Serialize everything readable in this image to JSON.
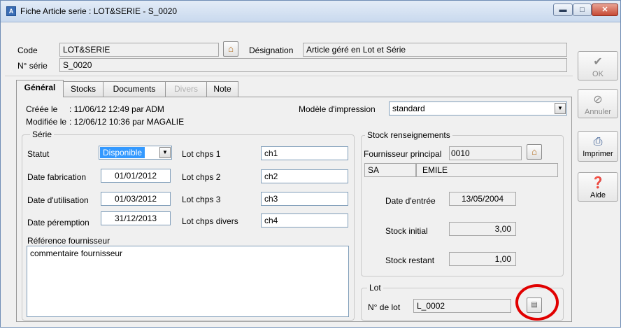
{
  "window": {
    "title": "Fiche Article serie : LOT&SERIE - S_0020",
    "icon": "app-icon",
    "controls": {
      "minimize": "▬",
      "maximize": "□",
      "close": "✕"
    }
  },
  "header": {
    "code_label": "Code",
    "code_value": "LOT&SERIE",
    "designation_label": "Désignation",
    "designation_value": "Article géré en Lot et Série",
    "serial_label": "N° série",
    "serial_value": "S_0020"
  },
  "sidebar": {
    "ok": "OK",
    "cancel": "Annuler",
    "print": "Imprimer",
    "help": "Aide"
  },
  "tabs": [
    {
      "label": "Général",
      "active": true
    },
    {
      "label": "Stocks"
    },
    {
      "label": "Documents"
    },
    {
      "label": "Divers",
      "disabled": true
    },
    {
      "label": "Note"
    }
  ],
  "general": {
    "created_label": "Créée le",
    "created_value": ": 11/06/12 12:49 par ADM",
    "modified_label": "Modifiée le",
    "modified_value": ": 12/06/12 10:36 par MAGALIE",
    "print_model_label": "Modèle d'impression",
    "print_model_value": "standard"
  },
  "serie": {
    "title": "Série",
    "status_label": "Statut",
    "status_value": "Disponible",
    "fabrication_label": "Date fabrication",
    "fabrication_value": "01/01/2012",
    "usage_label": "Date d'utilisation",
    "usage_value": "01/03/2012",
    "expiry_label": "Date péremption",
    "expiry_value": "31/12/2013",
    "lot1_label": "Lot chps 1",
    "lot1_value": "ch1",
    "lot2_label": "Lot chps 2",
    "lot2_value": "ch2",
    "lot3_label": "Lot chps 3",
    "lot3_value": "ch3",
    "lotdiv_label": "Lot chps divers",
    "lotdiv_value": "ch4",
    "supplier_ref_label": "Référence fournisseur",
    "supplier_ref_value": "commentaire fournisseur"
  },
  "stock": {
    "title": "Stock renseignements",
    "main_supplier_label": "Fournisseur principal",
    "main_supplier_code": "0010",
    "supplier_type": "SA",
    "supplier_name": "EMILE",
    "entry_date_label": "Date d'entrée",
    "entry_date_value": "13/05/2004",
    "initial_stock_label": "Stock initial",
    "initial_stock_value": "3,00",
    "remaining_stock_label": "Stock restant",
    "remaining_stock_value": "1,00"
  },
  "lot": {
    "title": "Lot",
    "number_label": "N° de lot",
    "number_value": "L_0002"
  },
  "colors": {
    "highlight": "#3399ff",
    "annotation": "#e10000"
  }
}
